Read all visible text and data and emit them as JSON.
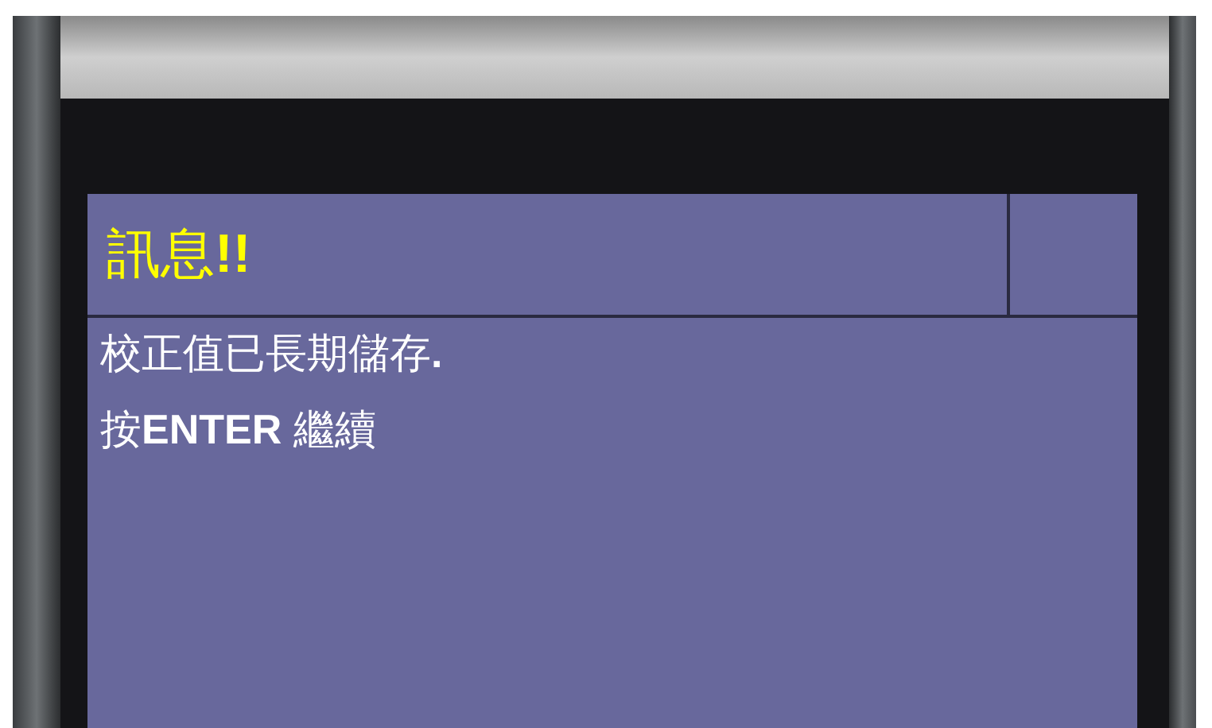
{
  "dialog": {
    "title": "訊息**!!**",
    "lines": [
      "校正值已長期儲存**.**",
      "按**ENTER** 繼續"
    ]
  }
}
